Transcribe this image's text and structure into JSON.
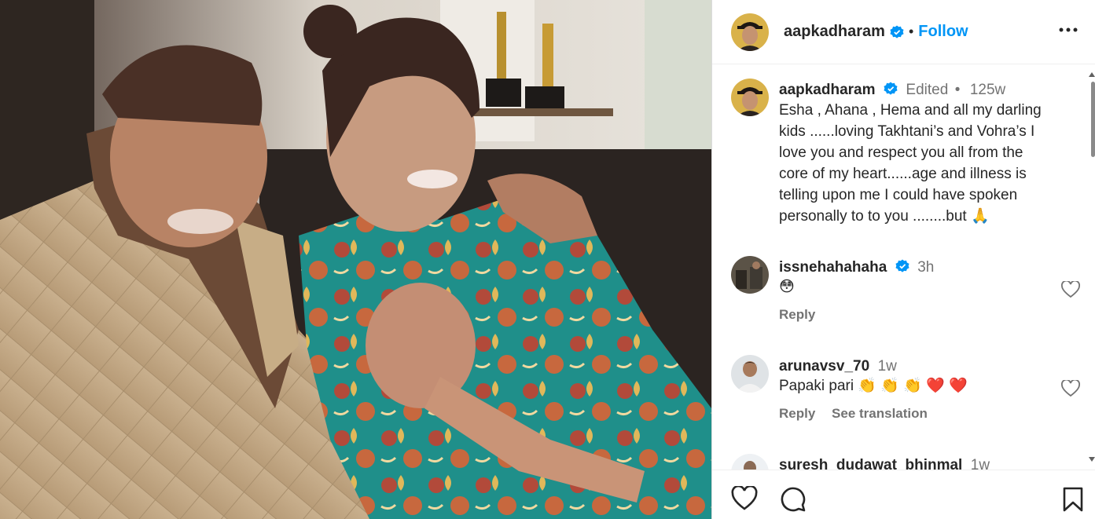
{
  "post": {
    "username": "aapkadharam",
    "follow_label": "Follow",
    "separator": "•"
  },
  "caption": {
    "username": "aapkadharam",
    "edited_label": "Edited",
    "separator": "•",
    "time": "125w",
    "lines": [
      "Esha , Ahana , Hema and all my darling",
      "kids ......loving Takhtani’s and Vohra’s  I",
      "love you and respect you  all from the",
      "core of my heart......age and illness is",
      "telling upon me I could have spoken",
      "personally to to you ........but 🙏"
    ]
  },
  "comments": [
    {
      "username": "issnehahahaha",
      "verified": true,
      "time": "3h",
      "text": "😳",
      "reply_label": "Reply"
    },
    {
      "username": "arunavsv_70",
      "verified": false,
      "time": "1w",
      "text": "Papaki pari 👏 👏 👏 ❤️ ❤️",
      "reply_label": "Reply",
      "translate_label": "See translation"
    },
    {
      "username": "suresh_dudawat_bhinmal",
      "verified": false,
      "time": "1w"
    }
  ],
  "colors": {
    "accent": "#0095f6",
    "verified": "#0095f6",
    "muted": "#737373",
    "text": "#262626"
  },
  "icons": {
    "verified": "verified-badge-icon",
    "more": "more-options-icon",
    "like": "heart-icon",
    "comment": "comment-icon",
    "save": "bookmark-icon"
  }
}
